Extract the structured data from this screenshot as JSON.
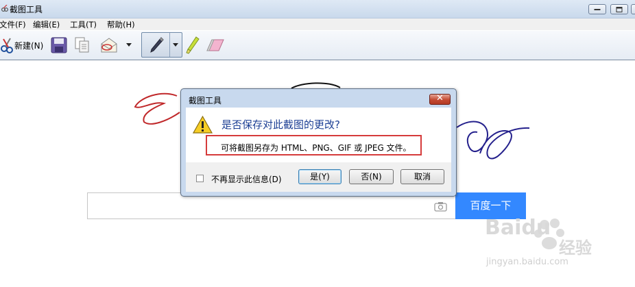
{
  "window": {
    "title": "截图工具"
  },
  "menu": [
    "文件(F)",
    "编辑(E)",
    "工具(T)",
    "帮助(H)"
  ],
  "toolbar": {
    "new_label": "新建(N)"
  },
  "dialog": {
    "title": "截图工具",
    "heading": "是否保存对此截图的更改?",
    "info": "可将截图另存为 HTML、PNG、GIF 或 JPEG 文件。",
    "checkbox_label": "不再显示此信息(D)",
    "checkbox_checked": false,
    "yes_label": "是(Y)",
    "no_label": "否(N)",
    "cancel_label": "取消"
  },
  "search": {
    "value": "",
    "button_label": "百度一下"
  },
  "watermark": {
    "brand": "Baidu",
    "brand_cn": "经验",
    "url": "jingyan.baidu.com"
  },
  "colors": {
    "ink_red": "#c0282a",
    "ink_blue": "#24208c",
    "search_button": "#3388ff",
    "highlight_box": "#d53a3a"
  }
}
